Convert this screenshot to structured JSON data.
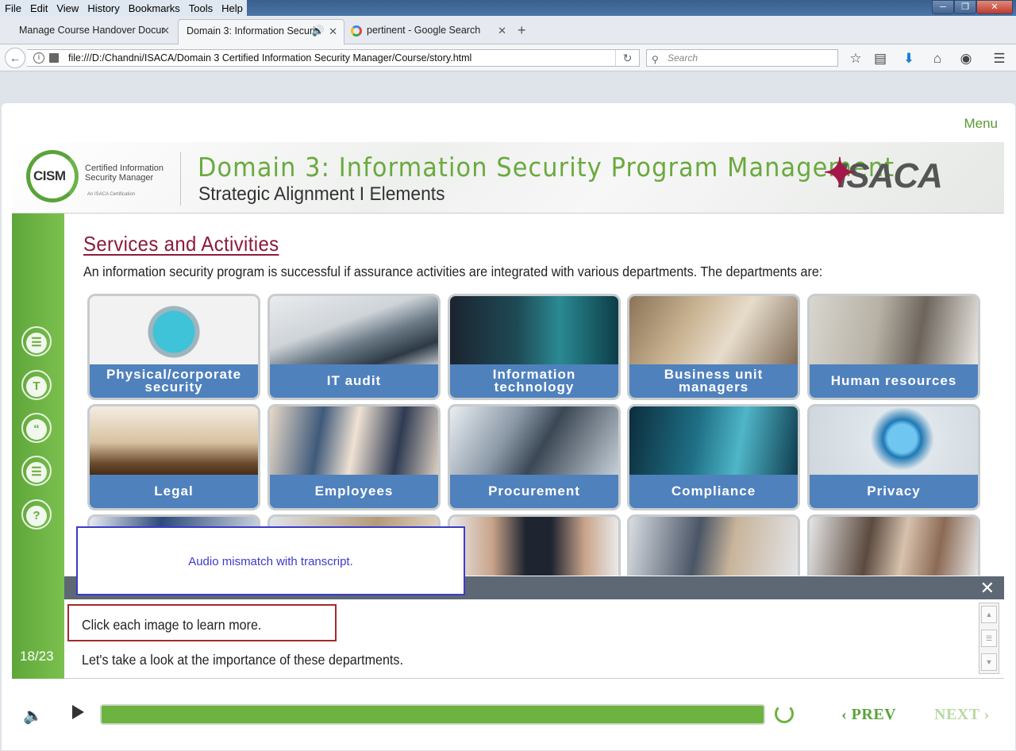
{
  "browser": {
    "menus": [
      "File",
      "Edit",
      "View",
      "History",
      "Bookmarks",
      "Tools",
      "Help"
    ],
    "tabs": [
      {
        "label": "Manage Course Handover Docur"
      },
      {
        "label": "Domain 3: Information Securi"
      },
      {
        "label": "pertinent - Google Search"
      }
    ],
    "url": "file:///D:/Chandni/ISACA/Domain 3 Certified Information Security Manager/Course/story.html",
    "search_placeholder": "Search"
  },
  "player": {
    "menu_label": "Menu",
    "banner": {
      "logo_text": "CISM",
      "logo_caption": "Certified Information Security Manager",
      "logo_sub": "An ISACA Certification",
      "title": "Domain 3: Information Security Program Management",
      "subtitle": "Strategic Alignment I Elements",
      "brand": "ISACA"
    },
    "section_title": "Services and Activities",
    "intro": "An information security program is successful if assurance activities are integrated with various departments. The departments are:",
    "cards": [
      {
        "label": "Physical/corporate security"
      },
      {
        "label": "IT audit"
      },
      {
        "label": "Information technology"
      },
      {
        "label": "Business unit managers"
      },
      {
        "label": "Human resources"
      },
      {
        "label": "Legal"
      },
      {
        "label": "Employees"
      },
      {
        "label": "Procurement"
      },
      {
        "label": "Compliance"
      },
      {
        "label": "Privacy"
      },
      {
        "label": ""
      },
      {
        "label": ""
      },
      {
        "label": ""
      },
      {
        "label": ""
      },
      {
        "label": ""
      }
    ],
    "popup_note": "Audio mismatch with transcript.",
    "transcript": {
      "line1": "Click each image to learn more.",
      "line2": "Let's take a look at the importance of these departments."
    },
    "page_counter": "18/23",
    "progress_fraction": 1.0,
    "prev_label": "PREV",
    "next_label": "NEXT",
    "colors": {
      "accent": "#6aaa3e",
      "title": "#8c1a3c",
      "card": "#4f81bd"
    }
  }
}
